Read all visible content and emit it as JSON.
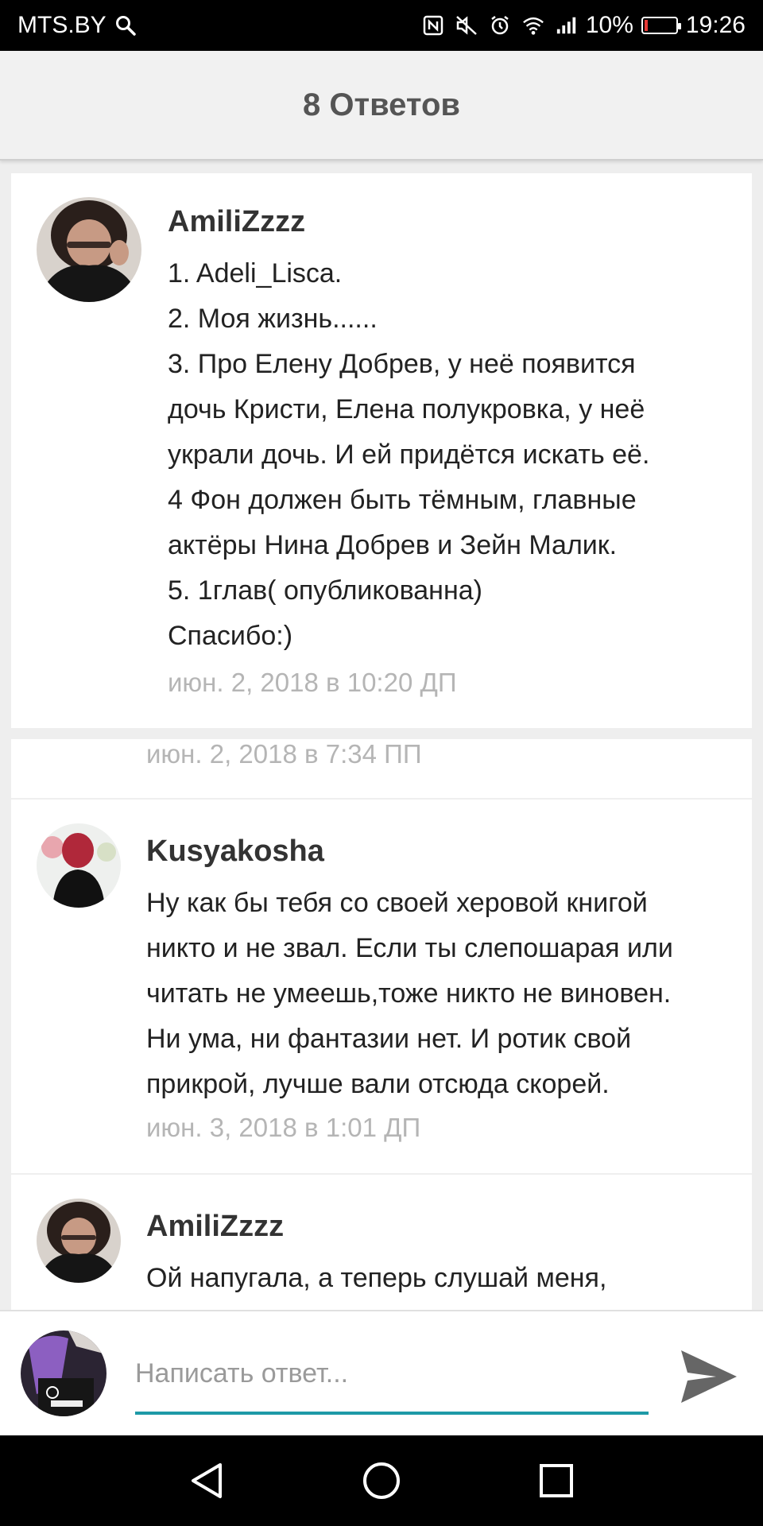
{
  "status_bar": {
    "carrier": "MTS.BY",
    "battery_percent": "10%",
    "battery_level": 0.1,
    "time": "19:26",
    "icons": [
      "search-icon",
      "nfc-icon",
      "mute-icon",
      "alarm-icon",
      "wifi-icon",
      "signal-icon",
      "battery-icon"
    ]
  },
  "header": {
    "title": "8 Ответов"
  },
  "original_post": {
    "author": "AmiliZzzz",
    "text": "1. Adeli_Lisca.\n2. Моя жизнь......\n3. Про Елену Добрев, у неё появится\nдочь Кристи, Елена полукровка,  у неё\nукрали дочь. И ей придётся искать её.\n4 Фон должен быть тёмным, главные\nактёры Нина Добрев и Зейн Малик.\n5. 1глав( опубликованна)\nСпасибо:)",
    "timestamp": "июн. 2, 2018 в 10:20 ДП"
  },
  "replies": [
    {
      "timestamp": "июн. 2, 2018 в 7:34 ПП"
    },
    {
      "author": "Kusyakosha",
      "text": "Ну как бы тебя со своей херовой книгой\nникто и не звал. Если ты слепошарая или\nчитать не умеешь,тоже никто не виновен.\nНи ума, ни фантазии нет. И ротик свой\nприкрой, лучше вали отсюда скорей.",
      "timestamp": "июн. 3, 2018 в 1:01 ДП"
    },
    {
      "author": "AmiliZzzz",
      "text": "Ой напугала,  а теперь слушай меня,"
    }
  ],
  "reply_bar": {
    "placeholder": "Написать ответ...",
    "accent_color": "#1e9aa7"
  },
  "colors": {
    "timestamp": "#b5b5b5",
    "header_bg": "#f1f1f1",
    "battery_low": "#e53935"
  }
}
